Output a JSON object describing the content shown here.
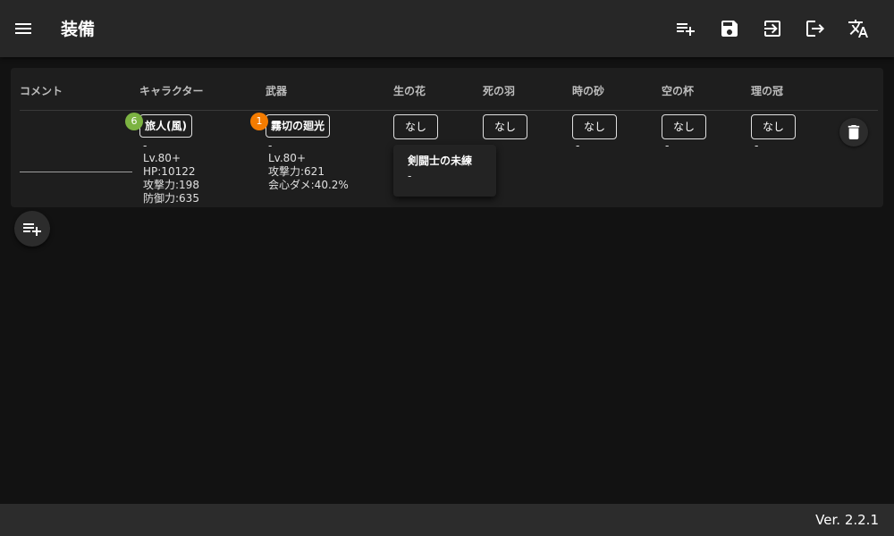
{
  "app": {
    "title": "装備",
    "version": "Ver. 2.2.1"
  },
  "toolbar": {
    "actions": [
      "add-list-icon",
      "save-icon",
      "import-icon",
      "export-icon",
      "translate-icon"
    ]
  },
  "table": {
    "headers": {
      "comment": "コメント",
      "character": "キャラクター",
      "weapon": "武器",
      "flower": "生の花",
      "plume": "死の羽",
      "sands": "時の砂",
      "goblet": "空の杯",
      "circlet": "理の冠"
    },
    "row": {
      "comment": "",
      "character": {
        "name": "旅人(風)",
        "badge": "6",
        "badge_color": "#7cb342",
        "dash": "-",
        "level": "Lv.80+",
        "hp": "HP:10122",
        "atk": "攻撃力:198",
        "def": "防御力:635"
      },
      "weapon": {
        "name": "霧切の廻光",
        "badge": "1",
        "badge_color": "#f57c00",
        "dash": "-",
        "level": "Lv.80+",
        "atk": "攻撃力:621",
        "sub": "会心ダメ:40.2%"
      },
      "artifacts": {
        "flower": {
          "label": "なし",
          "dash": "-"
        },
        "plume": {
          "label": "なし",
          "dash": "-"
        },
        "sands": {
          "label": "なし",
          "dash": "-"
        },
        "goblet": {
          "label": "なし",
          "dash": "-"
        },
        "circlet": {
          "label": "なし",
          "dash": "-"
        }
      }
    }
  },
  "tooltip": {
    "title": "剣闘士の未練",
    "subtitle": "-"
  },
  "colors": {
    "background": "#121212",
    "appbar": "#272727",
    "card": "#1e1e1e",
    "footer": "#2c2c2c"
  }
}
